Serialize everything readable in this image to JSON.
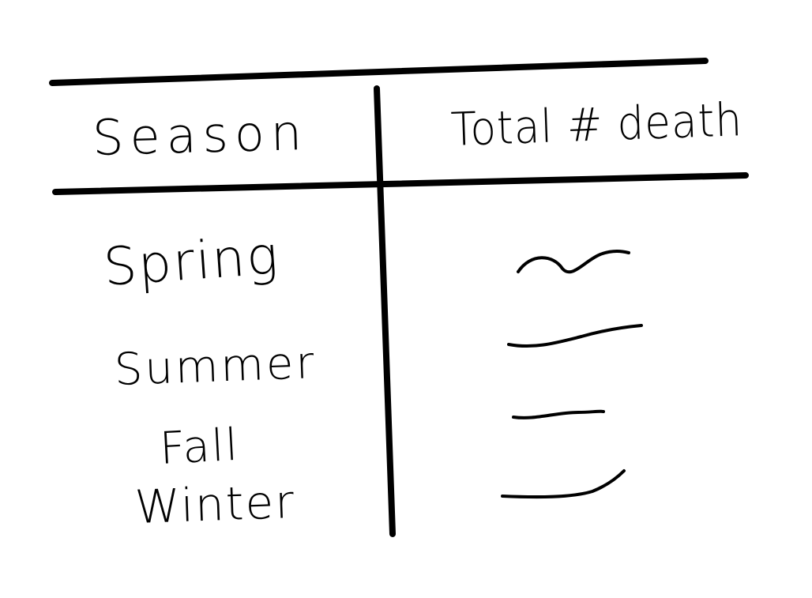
{
  "table": {
    "headers": [
      "Season",
      "Total # death"
    ],
    "rows": [
      {
        "season": "Spring",
        "total": ""
      },
      {
        "season": "Summer",
        "total": ""
      },
      {
        "season": "Fall",
        "total": ""
      },
      {
        "season": "Winter",
        "total": ""
      }
    ]
  },
  "ink_color": "#000000"
}
